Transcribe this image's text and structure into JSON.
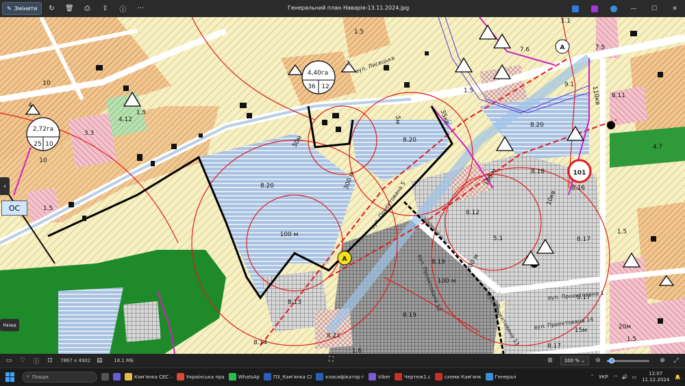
{
  "window": {
    "title": "Генеральний план Наварія-13.11.2024.jpg",
    "edit_label": "Змінити"
  },
  "map": {
    "area_labels": [
      "1.5",
      "4,40га",
      "36",
      "12",
      "2,72га",
      "25",
      "10",
      "3.3",
      "4.12",
      "1.5",
      "8.20",
      "8.20",
      "8.20",
      "9.1",
      "8.11",
      "8.18",
      "8.16",
      "4.7",
      "8.12",
      "5.1",
      "8.17",
      "1.5",
      "8.19",
      "8.17",
      "8.13",
      "8.14",
      "8.19",
      "8.21",
      "1.6",
      "8.17",
      "1.5",
      "1.5",
      "7.5",
      "1.1",
      "7.6",
      "1.5",
      "10",
      "10",
      "2",
      "4",
      "50м",
      "5м",
      "300 м",
      "100 м",
      "100 м",
      "300 м",
      "100 м",
      "15м",
      "20м",
      "101",
      "35кв",
      "110кв",
      "10кв"
    ],
    "street_labels": [
      "вул. Лисецька",
      "вул. Проектована 5",
      "вул. Проектована 13",
      "вул. Проектована 14",
      "вул. Проектована 1",
      "вул. Проектована 12"
    ],
    "marker_a": "A",
    "overlay_os": "ОС",
    "back_label": "Назад"
  },
  "status": {
    "dimensions": "7867 x 4902",
    "file_size": "18.1 МБ",
    "zoom": "100 %",
    "zoom_fraction": 0.12
  },
  "taskbar": {
    "search_placeholder": "Пошук",
    "items": [
      {
        "label": "Кам'янка СЕС –",
        "color": "#e8b84a"
      },
      {
        "label": "Українська пра",
        "color": "#d94a3a"
      },
      {
        "label": "WhatsAp",
        "color": "#27c04e"
      },
      {
        "label": "П3_Кам'янка СІ",
        "color": "#2b5fb8"
      },
      {
        "label": "класифікатор г",
        "color": "#2b5fb8"
      },
      {
        "label": "Viber",
        "color": "#7b5bd6"
      },
      {
        "label": "Чертеж1.c",
        "color": "#c8302c"
      },
      {
        "label": "схеми Кам'янк",
        "color": "#c8302c"
      },
      {
        "label": "Генерал",
        "color": "#3a8fd8"
      }
    ],
    "lang": "УКР",
    "time": "12:07",
    "date": "11.12.2024"
  }
}
